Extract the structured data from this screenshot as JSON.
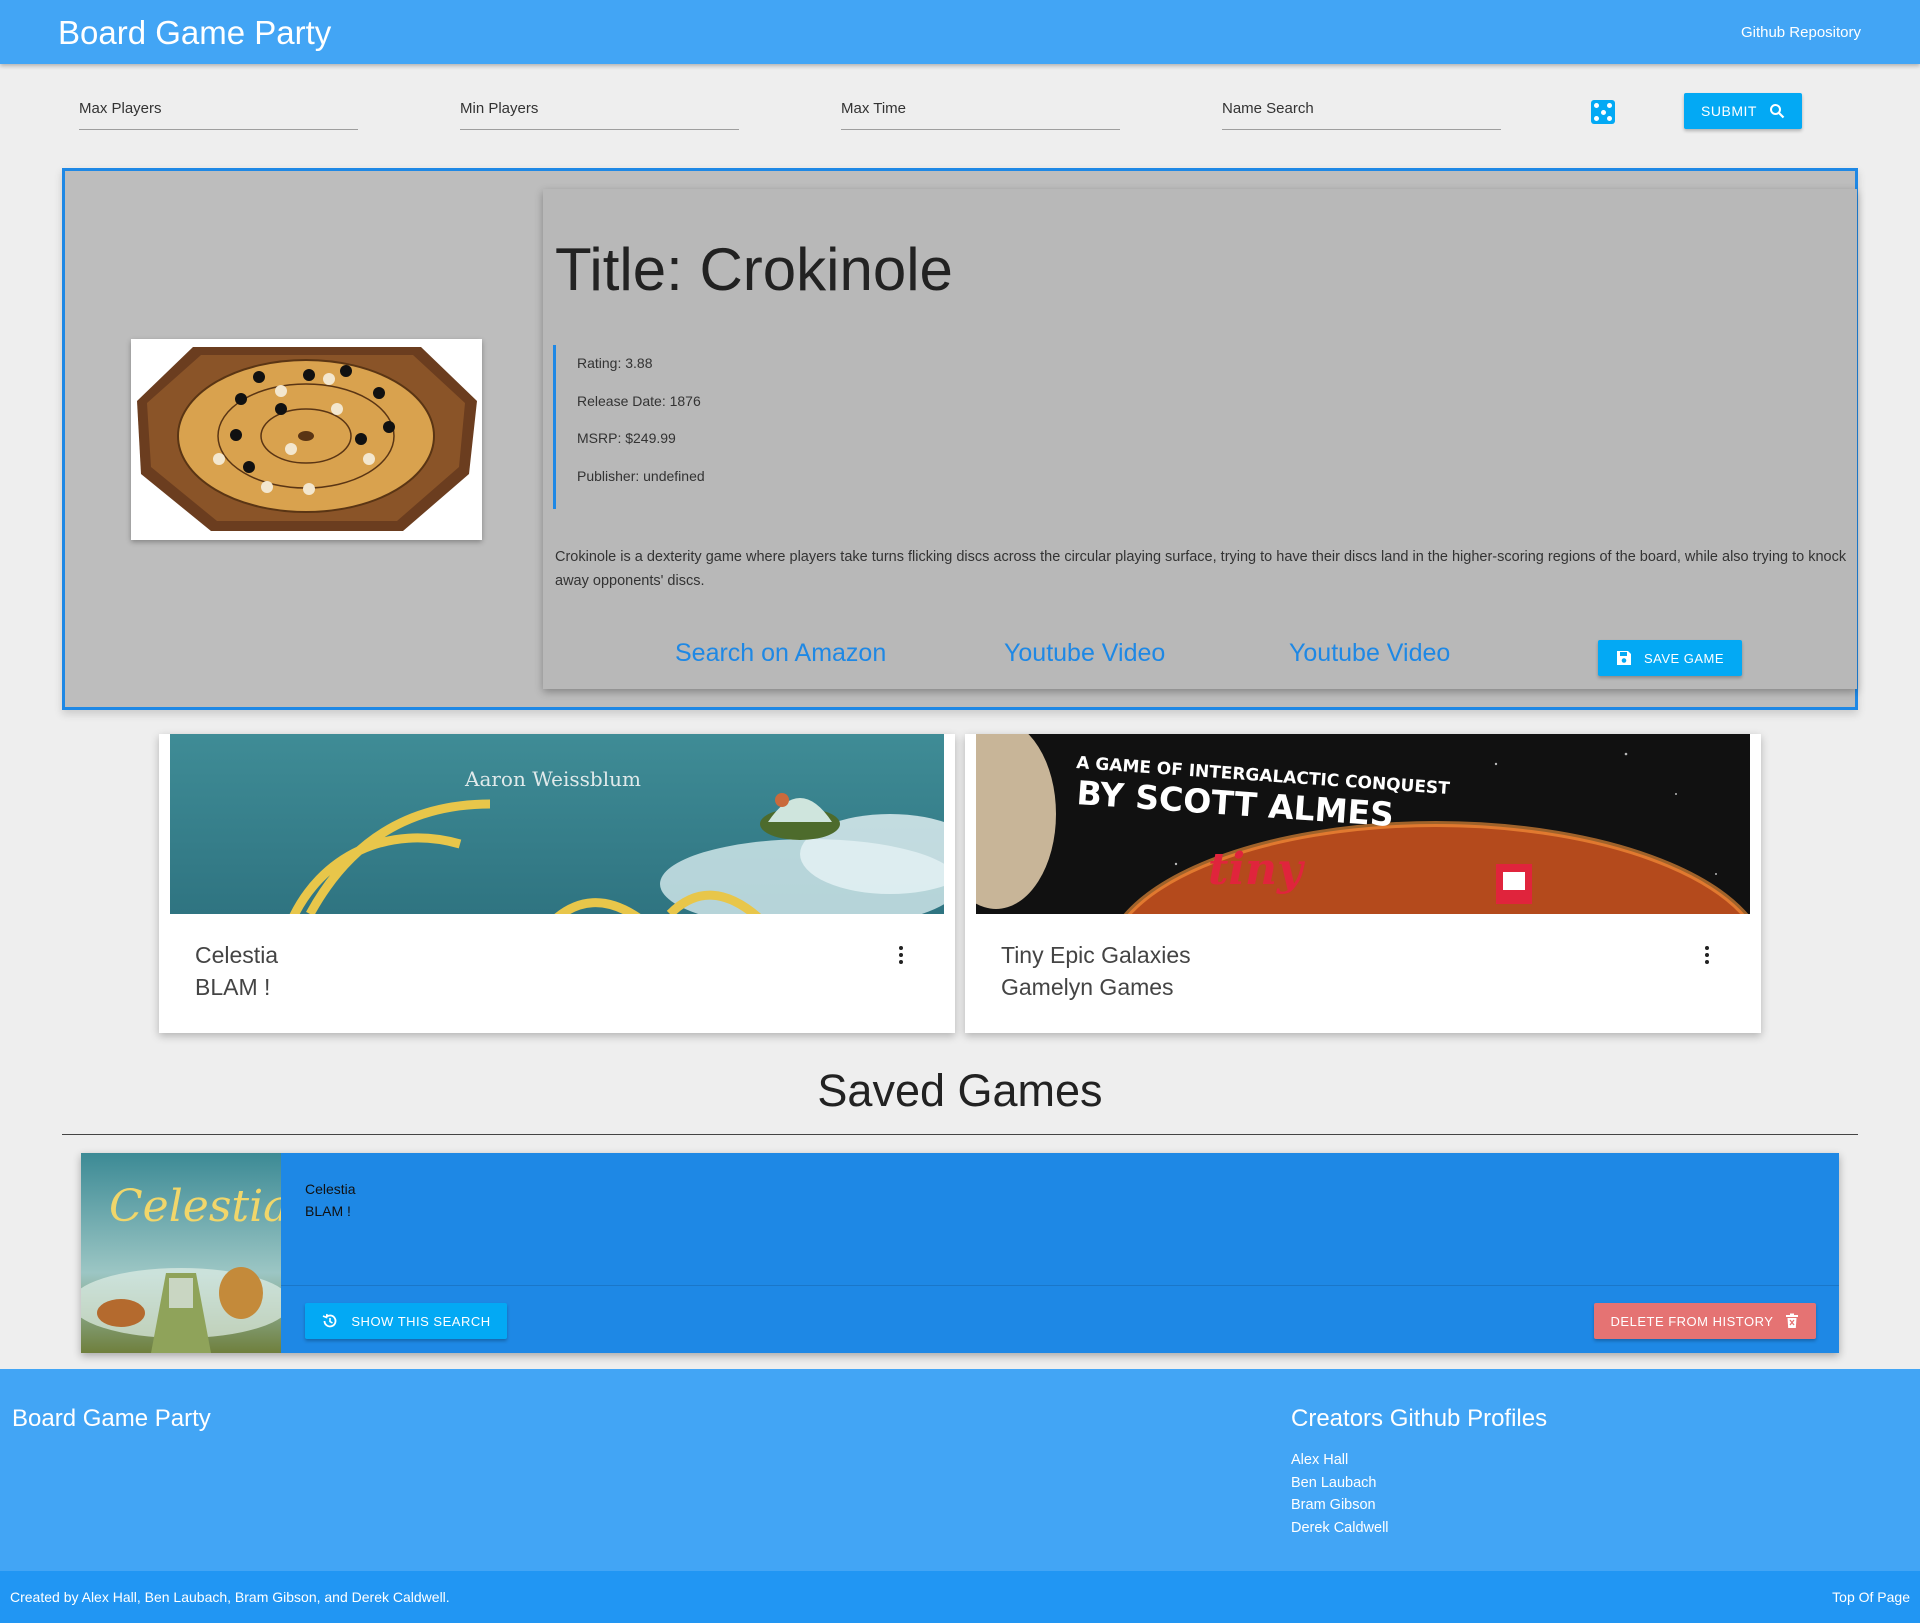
{
  "nav": {
    "brand": "Board Game Party",
    "repo_link": "Github Repository"
  },
  "search": {
    "max_players_label": "Max Players",
    "min_players_label": "Min Players",
    "max_time_label": "Max Time",
    "name_search_label": "Name Search",
    "random_icon": "dice-icon",
    "submit_label": "SUBMIT",
    "submit_icon": "search-icon"
  },
  "featured": {
    "title": "Title: Crokinole",
    "rating": "Rating: 3.88",
    "release_date": "Release Date: 1876",
    "msrp": "MSRP: $249.99",
    "publisher": "Publisher: undefined",
    "description": "Crokinole is a dexterity game where players take turns flicking discs across the circular playing surface, trying to have their discs land in the higher-scoring regions of the board, while also trying to knock away opponents' discs.",
    "link_amazon": "Search on Amazon",
    "link_youtube_1": "Youtube Video",
    "link_youtube_2": "Youtube Video",
    "save_label": "SAVE GAME",
    "save_icon": "floppy-disk-icon"
  },
  "results": [
    {
      "name": "Celestia",
      "publisher": "BLAM !",
      "banner_text": "Aaron Weissblum",
      "menu_icon": "more-vert-icon"
    },
    {
      "name": "Tiny Epic Galaxies",
      "publisher": "Gamelyn Games",
      "banner_text_1": "A GAME OF INTERGALACTIC CONQUEST",
      "banner_text_2": "BY SCOTT ALMES",
      "banner_text_3": "tiny",
      "menu_icon": "more-vert-icon"
    }
  ],
  "saved": {
    "heading": "Saved Games",
    "items": [
      {
        "name": "Celestia",
        "publisher": "BLAM !",
        "thumb_text": "Celestia",
        "show_label": "SHOW THIS SEARCH",
        "show_icon": "history-icon",
        "delete_label": "DELETE FROM HISTORY",
        "delete_icon": "trash-icon"
      }
    ]
  },
  "footer": {
    "brand": "Board Game Party",
    "creators_heading": "Creators Github Profiles",
    "creators": [
      "Alex Hall",
      "Ben Laubach",
      "Bram Gibson",
      "Derek Caldwell"
    ],
    "copyright": "Created by Alex Hall, Ben Laubach, Bram Gibson, and Derek Caldwell.",
    "top_link": "Top Of Page"
  },
  "colors": {
    "nav": "#42a5f5",
    "accent": "#03a9f4",
    "saved_card": "#1e88e5",
    "delete": "#e57373",
    "footer_bottom": "#2196f3"
  }
}
